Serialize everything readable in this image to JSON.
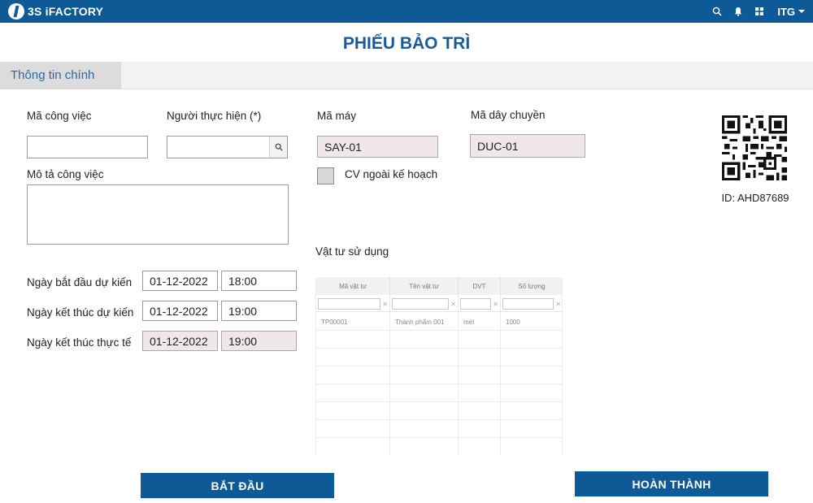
{
  "header": {
    "logo_text": "3S iFACTORY",
    "user": "ITG",
    "icons": [
      "search-icon",
      "bell-icon",
      "grid-icon"
    ]
  },
  "page": {
    "title": "PHIẾU BẢO TRÌ"
  },
  "tabs": [
    {
      "label": "Thông tin chính",
      "active": true
    }
  ],
  "form": {
    "job_code": {
      "label": "Mã công việc",
      "value": ""
    },
    "performer": {
      "label": "Người thực hiện (*)",
      "value": ""
    },
    "machine_code": {
      "label": "Mã máy",
      "value": "SAY-01"
    },
    "line_code": {
      "label": "Mã dây chuyền",
      "value": "DUC-01"
    },
    "unplanned": {
      "label": "CV ngoài kế hoạch",
      "checked": false
    },
    "description": {
      "label": "Mô tả công việc",
      "value": ""
    },
    "planned_start": {
      "label": "Ngày bắt đầu dự kiến",
      "date": "01-12-2022",
      "time": "18:00"
    },
    "planned_end": {
      "label": "Ngày kết thúc dự kiến",
      "date": "01-12-2022",
      "time": "19:00"
    },
    "actual_end": {
      "label": "Ngày kết thúc thực tế",
      "date": "01-12-2022",
      "time": "19:00"
    }
  },
  "qr": {
    "id_text": "ID: AHD87689"
  },
  "materials": {
    "title": "Vật tư sử dụng",
    "columns": [
      "Mã vật tư",
      "Tên vật tư",
      "DVT",
      "Số lượng"
    ],
    "rows": [
      [
        "TP00001",
        "Thành phẩm 001",
        "mét",
        "1000"
      ]
    ],
    "empty_rows": 7
  },
  "actions": {
    "start_label": "BẮT ĐẦU",
    "complete_label": "HOÀN THÀNH"
  },
  "colors": {
    "primary": "#0d5a96",
    "title": "#1a5c97",
    "readonly_bg": "#f0e8e8"
  }
}
